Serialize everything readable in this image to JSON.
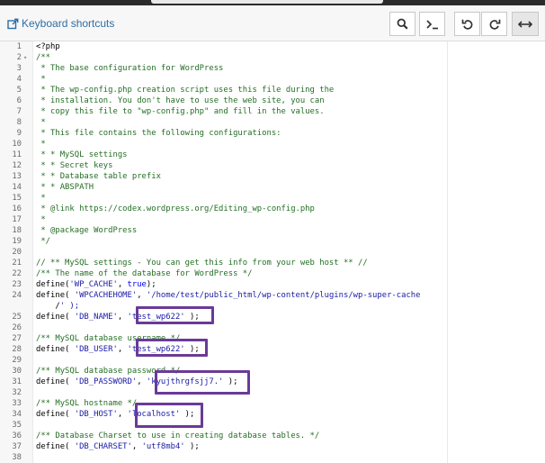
{
  "toolbar": {
    "shortcuts_label": "Keyboard shortcuts",
    "buttons": [
      {
        "name": "search-icon",
        "label": "Search"
      },
      {
        "name": "terminal-icon",
        "label": "Go to line"
      },
      {
        "name": "undo-icon",
        "label": "Undo"
      },
      {
        "name": "redo-icon",
        "label": "Redo"
      },
      {
        "name": "wrap-icon",
        "label": "Toggle word wrap"
      }
    ]
  },
  "editor": {
    "highlight_color": "#6a3a98",
    "lines": [
      {
        "n": "1",
        "code": "<?php"
      },
      {
        "n": "2",
        "code": "/**",
        "fold": true
      },
      {
        "n": "3",
        "code": " * The base configuration for WordPress"
      },
      {
        "n": "4",
        "code": " *"
      },
      {
        "n": "5",
        "code": " * The wp-config.php creation script uses this file during the"
      },
      {
        "n": "6",
        "code": " * installation. You don't have to use the web site, you can"
      },
      {
        "n": "7",
        "code": " * copy this file to \"wp-config.php\" and fill in the values."
      },
      {
        "n": "8",
        "code": " *"
      },
      {
        "n": "9",
        "code": " * This file contains the following configurations:"
      },
      {
        "n": "10",
        "code": " *"
      },
      {
        "n": "11",
        "code": " * * MySQL settings"
      },
      {
        "n": "12",
        "code": " * * Secret keys"
      },
      {
        "n": "13",
        "code": " * * Database table prefix"
      },
      {
        "n": "14",
        "code": " * * ABSPATH"
      },
      {
        "n": "15",
        "code": " *"
      },
      {
        "n": "16",
        "code": " * @link https://codex.wordpress.org/Editing_wp-config.php"
      },
      {
        "n": "17",
        "code": " *"
      },
      {
        "n": "18",
        "code": " * @package WordPress"
      },
      {
        "n": "19",
        "code": " */"
      },
      {
        "n": "20",
        "code": ""
      },
      {
        "n": "21",
        "code": "// ** MySQL settings - You can get this info from your web host ** //"
      },
      {
        "n": "22",
        "code": "/** The name of the database for WordPress */"
      },
      {
        "n": "23",
        "code": "define('WP_CACHE', true);"
      },
      {
        "n": "24",
        "code": "define( 'WPCACHEHOME', '/home/test/public_html/wp-content/plugins/wp-super-cache"
      },
      {
        "n": "",
        "code": "    /' );"
      },
      {
        "n": "25",
        "code": "define( 'DB_NAME', 'test_wp622' );"
      },
      {
        "n": "26",
        "code": ""
      },
      {
        "n": "27",
        "code": "/** MySQL database username */"
      },
      {
        "n": "28",
        "code": "define( 'DB_USER', 'test_wp622' );"
      },
      {
        "n": "29",
        "code": ""
      },
      {
        "n": "30",
        "code": "/** MySQL database password */"
      },
      {
        "n": "31",
        "code": "define( 'DB_PASSWORD', 'kyujthrgfsjj7.' );"
      },
      {
        "n": "32",
        "code": ""
      },
      {
        "n": "33",
        "code": "/** MySQL hostname */"
      },
      {
        "n": "34",
        "code": "define( 'DB_HOST', 'localhost' );"
      },
      {
        "n": "35",
        "code": ""
      },
      {
        "n": "36",
        "code": "/** Database Charset to use in creating database tables. */"
      },
      {
        "n": "37",
        "code": "define( 'DB_CHARSET', 'utf8mb4' );"
      },
      {
        "n": "38",
        "code": ""
      }
    ]
  }
}
